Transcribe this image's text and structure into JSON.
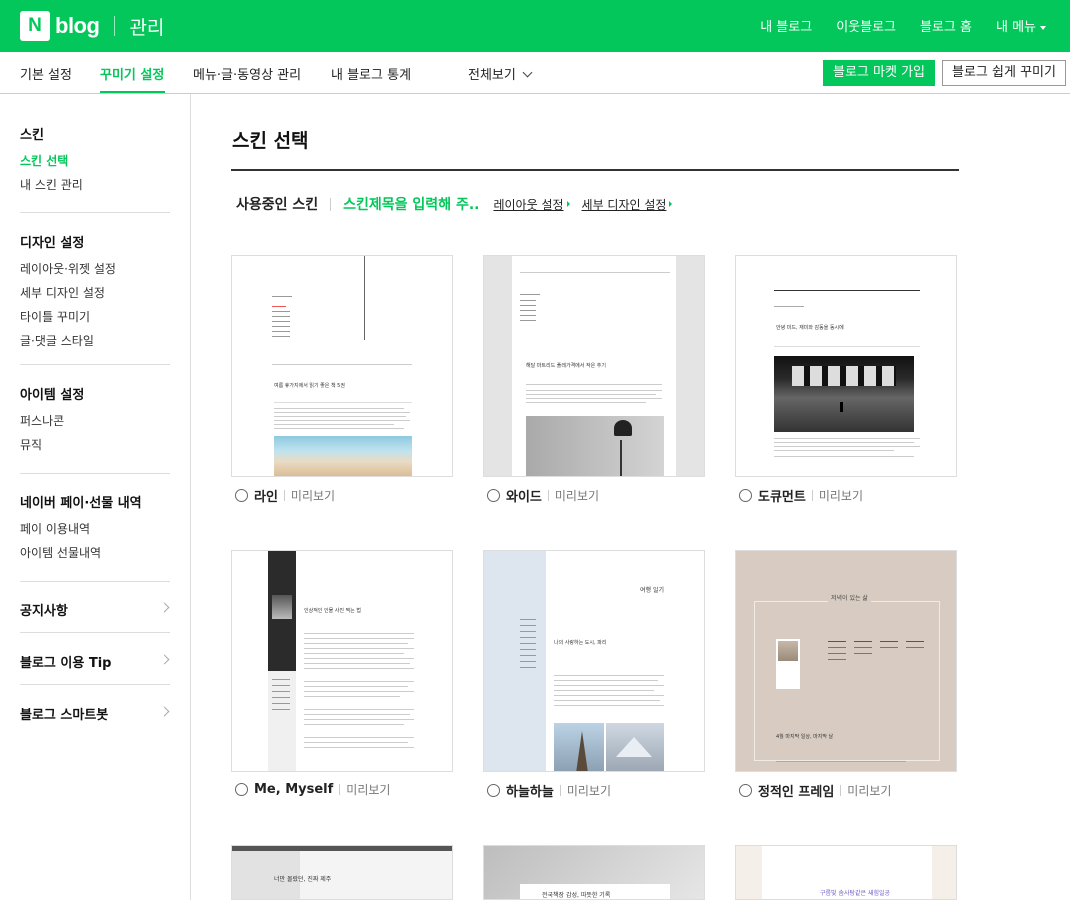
{
  "header": {
    "logo_n": "N",
    "logo_text": "blog",
    "admin_label": "관리",
    "links": [
      "내 블로그",
      "이웃블로그",
      "블로그 홈",
      "내 메뉴"
    ]
  },
  "nav": {
    "tabs": [
      "기본 설정",
      "꾸미기 설정",
      "메뉴·글·동영상 관리",
      "내 블로그 통계",
      "전체보기"
    ],
    "buttons": {
      "market": "블로그 마켓 가입",
      "easy": "블로그 쉽게 꾸미기"
    }
  },
  "sidebar": {
    "skin": {
      "title": "스킨",
      "items": [
        "스킨 선택",
        "내 스킨 관리"
      ]
    },
    "design": {
      "title": "디자인 설정",
      "items": [
        "레이아웃·위젯 설정",
        "세부 디자인 설정",
        "타이틀 꾸미기",
        "글·댓글 스타일"
      ]
    },
    "item": {
      "title": "아이템 설정",
      "items": [
        "퍼스나콘",
        "뮤직"
      ]
    },
    "pay": {
      "title": "네이버 페이·선물 내역",
      "items": [
        "페이 이용내역",
        "아이템 선물내역"
      ]
    },
    "links": [
      "공지사항",
      "블로그 이용 Tip",
      "블로그 스마트봇"
    ]
  },
  "main": {
    "title": "스킨 선택",
    "current_label": "사용중인 스킨",
    "current_skin": "스킨제목을 입력해 주..",
    "layout_link": "레이아웃 설정",
    "detail_link": "세부 디자인 설정",
    "preview_label": "미리보기",
    "skins": [
      {
        "name": "라인",
        "thumb_title": "여름 휴가지에서 읽기 좋은 책 5권"
      },
      {
        "name": "와이드",
        "thumb_title": "해달 마트리드 플레가격에서 작은 추기"
      },
      {
        "name": "도큐먼트",
        "thumb_title": "안녕 미드, 재미와 감동을 동시에"
      },
      {
        "name": "Me, Myself",
        "thumb_title": "인상적인 인물 사진 찍는 법"
      },
      {
        "name": "하늘하늘",
        "thumb_title": "나의 사랑하는 도시, 파리",
        "thumb_header": "여행 일기"
      },
      {
        "name": "정적인 프레임",
        "thumb_title": "4월 마지막 일상, 마지막 날",
        "thumb_header": "저녁이 있는 삶"
      },
      {
        "name": "",
        "thumb_title": "너만 몰랐던, 진짜 제주"
      },
      {
        "name": "",
        "thumb_title": "전국책장 감성, 따뜻한 기록"
      },
      {
        "name": "",
        "thumb_title": "구름빛 솜사탕같은 새힘일공"
      }
    ]
  },
  "colors": {
    "brand": "#03c75a",
    "text": "#222222",
    "muted": "#777777"
  }
}
